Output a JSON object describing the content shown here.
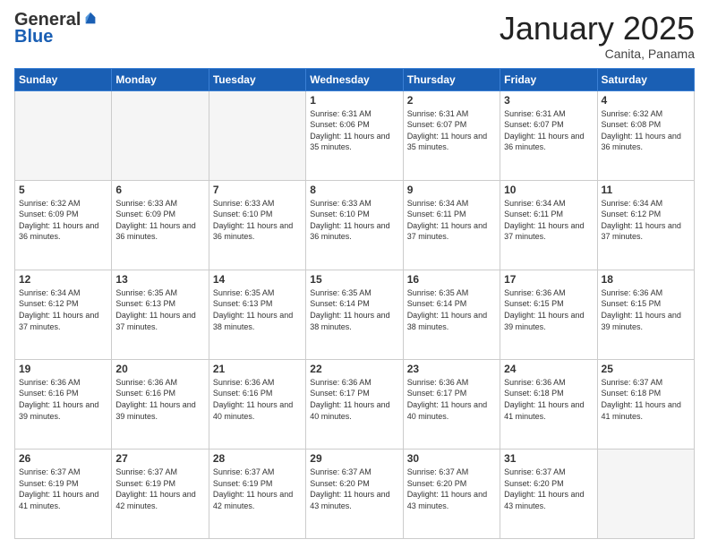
{
  "header": {
    "logo_general": "General",
    "logo_blue": "Blue",
    "month_title": "January 2025",
    "location": "Canita, Panama"
  },
  "weekdays": [
    "Sunday",
    "Monday",
    "Tuesday",
    "Wednesday",
    "Thursday",
    "Friday",
    "Saturday"
  ],
  "weeks": [
    [
      {
        "day": "",
        "info": ""
      },
      {
        "day": "",
        "info": ""
      },
      {
        "day": "",
        "info": ""
      },
      {
        "day": "1",
        "info": "Sunrise: 6:31 AM\nSunset: 6:06 PM\nDaylight: 11 hours and 35 minutes."
      },
      {
        "day": "2",
        "info": "Sunrise: 6:31 AM\nSunset: 6:07 PM\nDaylight: 11 hours and 35 minutes."
      },
      {
        "day": "3",
        "info": "Sunrise: 6:31 AM\nSunset: 6:07 PM\nDaylight: 11 hours and 36 minutes."
      },
      {
        "day": "4",
        "info": "Sunrise: 6:32 AM\nSunset: 6:08 PM\nDaylight: 11 hours and 36 minutes."
      }
    ],
    [
      {
        "day": "5",
        "info": "Sunrise: 6:32 AM\nSunset: 6:09 PM\nDaylight: 11 hours and 36 minutes."
      },
      {
        "day": "6",
        "info": "Sunrise: 6:33 AM\nSunset: 6:09 PM\nDaylight: 11 hours and 36 minutes."
      },
      {
        "day": "7",
        "info": "Sunrise: 6:33 AM\nSunset: 6:10 PM\nDaylight: 11 hours and 36 minutes."
      },
      {
        "day": "8",
        "info": "Sunrise: 6:33 AM\nSunset: 6:10 PM\nDaylight: 11 hours and 36 minutes."
      },
      {
        "day": "9",
        "info": "Sunrise: 6:34 AM\nSunset: 6:11 PM\nDaylight: 11 hours and 37 minutes."
      },
      {
        "day": "10",
        "info": "Sunrise: 6:34 AM\nSunset: 6:11 PM\nDaylight: 11 hours and 37 minutes."
      },
      {
        "day": "11",
        "info": "Sunrise: 6:34 AM\nSunset: 6:12 PM\nDaylight: 11 hours and 37 minutes."
      }
    ],
    [
      {
        "day": "12",
        "info": "Sunrise: 6:34 AM\nSunset: 6:12 PM\nDaylight: 11 hours and 37 minutes."
      },
      {
        "day": "13",
        "info": "Sunrise: 6:35 AM\nSunset: 6:13 PM\nDaylight: 11 hours and 37 minutes."
      },
      {
        "day": "14",
        "info": "Sunrise: 6:35 AM\nSunset: 6:13 PM\nDaylight: 11 hours and 38 minutes."
      },
      {
        "day": "15",
        "info": "Sunrise: 6:35 AM\nSunset: 6:14 PM\nDaylight: 11 hours and 38 minutes."
      },
      {
        "day": "16",
        "info": "Sunrise: 6:35 AM\nSunset: 6:14 PM\nDaylight: 11 hours and 38 minutes."
      },
      {
        "day": "17",
        "info": "Sunrise: 6:36 AM\nSunset: 6:15 PM\nDaylight: 11 hours and 39 minutes."
      },
      {
        "day": "18",
        "info": "Sunrise: 6:36 AM\nSunset: 6:15 PM\nDaylight: 11 hours and 39 minutes."
      }
    ],
    [
      {
        "day": "19",
        "info": "Sunrise: 6:36 AM\nSunset: 6:16 PM\nDaylight: 11 hours and 39 minutes."
      },
      {
        "day": "20",
        "info": "Sunrise: 6:36 AM\nSunset: 6:16 PM\nDaylight: 11 hours and 39 minutes."
      },
      {
        "day": "21",
        "info": "Sunrise: 6:36 AM\nSunset: 6:16 PM\nDaylight: 11 hours and 40 minutes."
      },
      {
        "day": "22",
        "info": "Sunrise: 6:36 AM\nSunset: 6:17 PM\nDaylight: 11 hours and 40 minutes."
      },
      {
        "day": "23",
        "info": "Sunrise: 6:36 AM\nSunset: 6:17 PM\nDaylight: 11 hours and 40 minutes."
      },
      {
        "day": "24",
        "info": "Sunrise: 6:36 AM\nSunset: 6:18 PM\nDaylight: 11 hours and 41 minutes."
      },
      {
        "day": "25",
        "info": "Sunrise: 6:37 AM\nSunset: 6:18 PM\nDaylight: 11 hours and 41 minutes."
      }
    ],
    [
      {
        "day": "26",
        "info": "Sunrise: 6:37 AM\nSunset: 6:19 PM\nDaylight: 11 hours and 41 minutes."
      },
      {
        "day": "27",
        "info": "Sunrise: 6:37 AM\nSunset: 6:19 PM\nDaylight: 11 hours and 42 minutes."
      },
      {
        "day": "28",
        "info": "Sunrise: 6:37 AM\nSunset: 6:19 PM\nDaylight: 11 hours and 42 minutes."
      },
      {
        "day": "29",
        "info": "Sunrise: 6:37 AM\nSunset: 6:20 PM\nDaylight: 11 hours and 43 minutes."
      },
      {
        "day": "30",
        "info": "Sunrise: 6:37 AM\nSunset: 6:20 PM\nDaylight: 11 hours and 43 minutes."
      },
      {
        "day": "31",
        "info": "Sunrise: 6:37 AM\nSunset: 6:20 PM\nDaylight: 11 hours and 43 minutes."
      },
      {
        "day": "",
        "info": ""
      }
    ]
  ]
}
